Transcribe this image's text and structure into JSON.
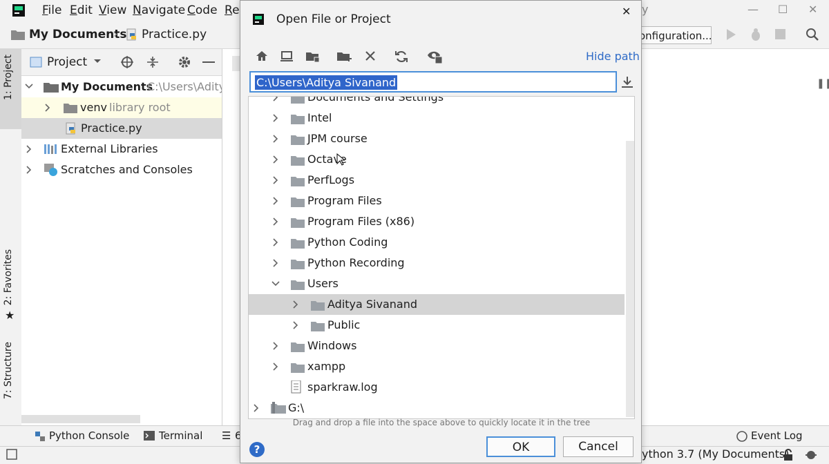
{
  "ide": {
    "menu": [
      {
        "label": "File",
        "underline": "F",
        "rest": "ile"
      },
      {
        "label": "Edit",
        "underline": "E",
        "rest": "dit"
      },
      {
        "label": "View",
        "underline": "V",
        "rest": "iew"
      },
      {
        "label": "Navigate",
        "underline": "N",
        "rest": "avigate"
      },
      {
        "label": "Code",
        "underline": "C",
        "rest": "ode"
      },
      {
        "label": "Re",
        "underline": "R",
        "rest": "e"
      }
    ],
    "title_fragment": "y",
    "breadcrumb": {
      "root": "My Documents",
      "file": "Practice.py"
    },
    "run_config_label": "onfiguration...",
    "side_tabs": {
      "project": "1: Project",
      "favorites": "2: Favorites",
      "structure": "7: Structure"
    },
    "project_panel": {
      "title": "Project",
      "tree": [
        {
          "label": "My Documents",
          "hint": "C:\\Users\\Adity"
        },
        {
          "label": "venv",
          "hint": "library root"
        },
        {
          "label": "Practice.py",
          "hint": ""
        },
        {
          "label": "External Libraries",
          "hint": ""
        },
        {
          "label": "Scratches and Consoles",
          "hint": ""
        }
      ]
    },
    "editor_tab_fragment": "6",
    "bottom_tools": {
      "python_console": "Python Console",
      "terminal": "Terminal",
      "event_log": "Event Log"
    },
    "status_interpreter": "ython 3.7 (My Documents)"
  },
  "dialog": {
    "title": "Open File or Project",
    "hide_path": "Hide path",
    "path_value": "C:\\Users\\Aditya Sivanand",
    "partial_top_row": "Documents and Settings",
    "tree_rows": [
      {
        "label": "Intel",
        "level": 1,
        "type": "folder",
        "expand": "collapsed"
      },
      {
        "label": "JPM course",
        "level": 1,
        "type": "folder",
        "expand": "collapsed"
      },
      {
        "label": "Octave",
        "level": 1,
        "type": "folder",
        "expand": "collapsed"
      },
      {
        "label": "PerfLogs",
        "level": 1,
        "type": "folder",
        "expand": "collapsed"
      },
      {
        "label": "Program Files",
        "level": 1,
        "type": "folder",
        "expand": "collapsed"
      },
      {
        "label": "Program Files (x86)",
        "level": 1,
        "type": "folder",
        "expand": "collapsed"
      },
      {
        "label": "Python Coding",
        "level": 1,
        "type": "folder",
        "expand": "collapsed"
      },
      {
        "label": "Python Recording",
        "level": 1,
        "type": "folder",
        "expand": "collapsed"
      },
      {
        "label": "Users",
        "level": 1,
        "type": "folder",
        "expand": "expanded"
      },
      {
        "label": "Aditya Sivanand",
        "level": 2,
        "type": "folder",
        "expand": "collapsed",
        "selected": true
      },
      {
        "label": "Public",
        "level": 2,
        "type": "folder",
        "expand": "collapsed"
      },
      {
        "label": "Windows",
        "level": 1,
        "type": "folder",
        "expand": "collapsed"
      },
      {
        "label": "xampp",
        "level": 1,
        "type": "folder",
        "expand": "collapsed"
      },
      {
        "label": "sparkraw.log",
        "level": 1,
        "type": "file",
        "expand": "none"
      },
      {
        "label": "G:\\",
        "level": 0,
        "type": "drive",
        "expand": "collapsed"
      }
    ],
    "hint": "Drag and drop a file into the space above to quickly locate it in the tree",
    "ok_label": "OK",
    "cancel_label": "Cancel"
  },
  "colors": {
    "accent": "#2f65ca",
    "selection": "#d4d4d4",
    "folder": "#9aa0a6",
    "focus_border": "#4a8fd9"
  }
}
